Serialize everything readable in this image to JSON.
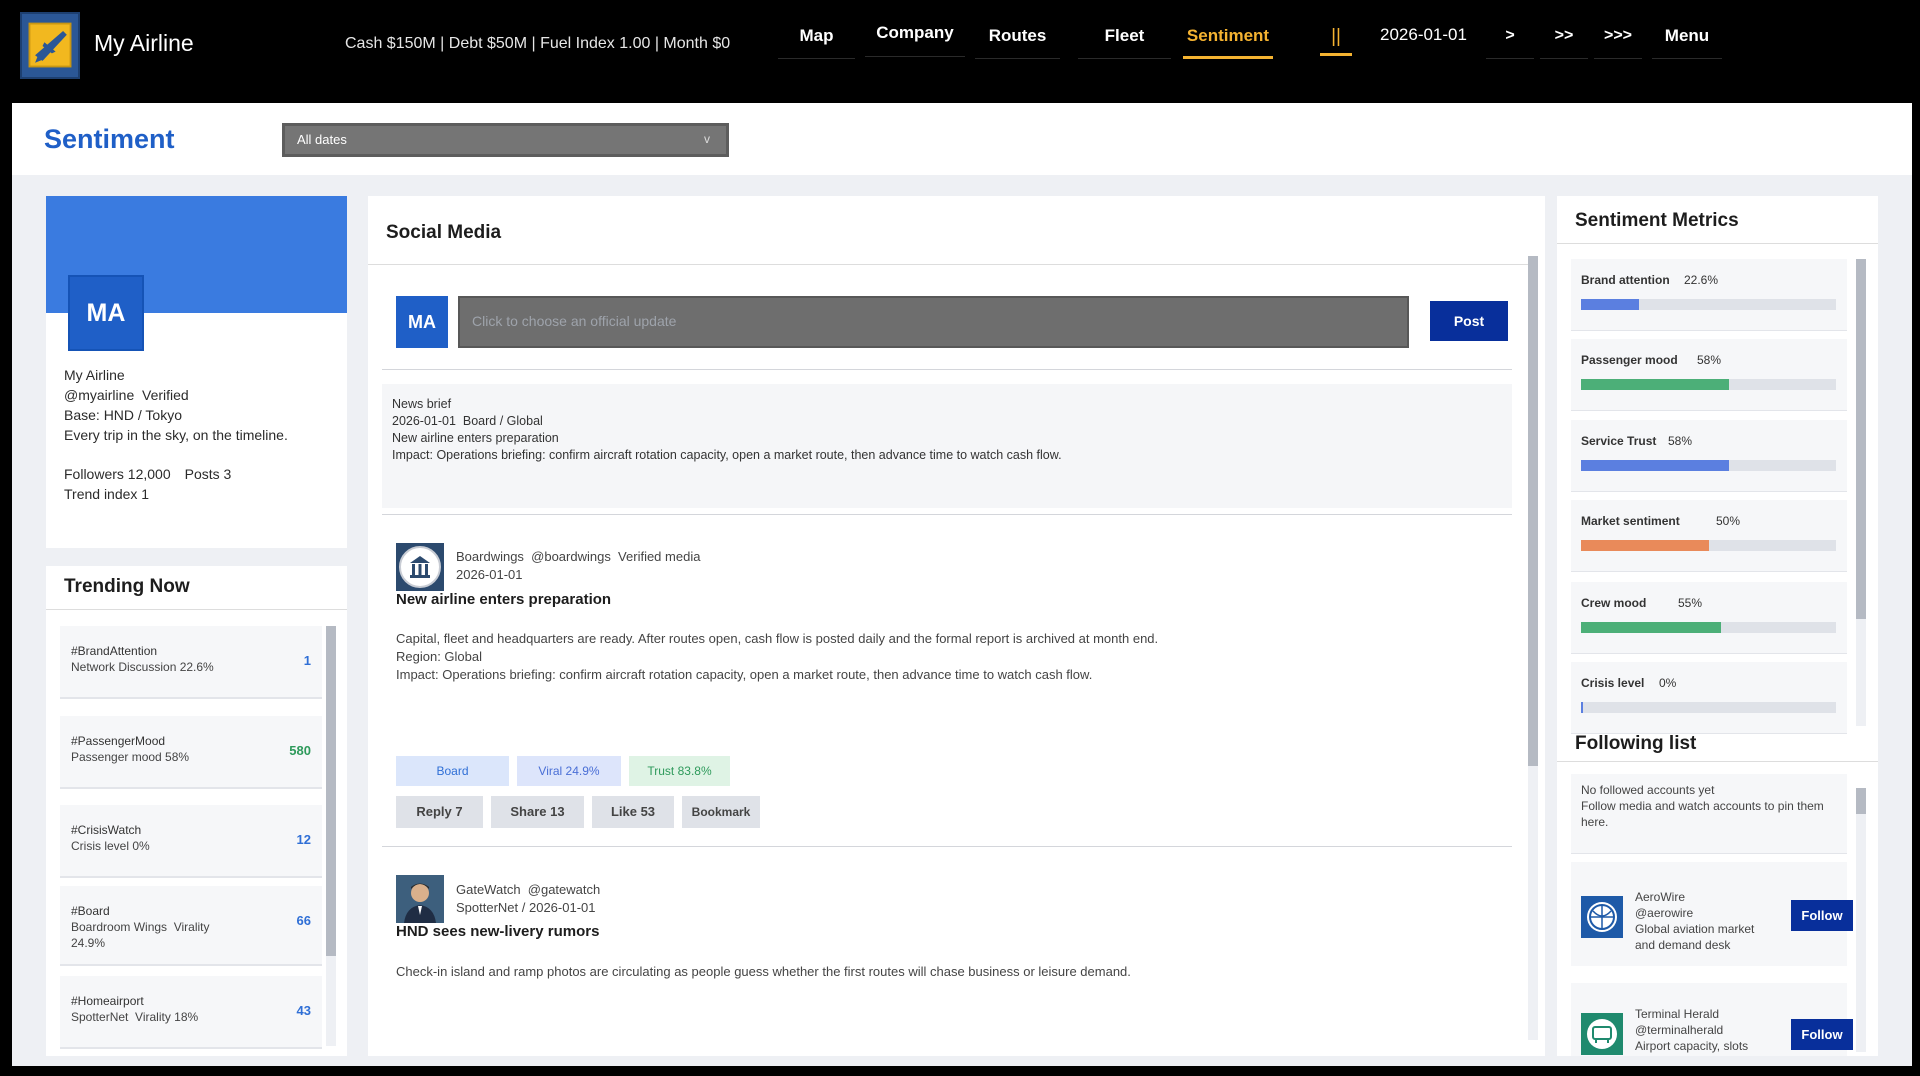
{
  "app": {
    "title": "My Airline",
    "logo_icon": "airline-plane-logo",
    "stats": "Cash $150M | Debt $50M | Fuel Index 1.00 | Month $0"
  },
  "nav": {
    "map": "Map",
    "company": "Company",
    "routes": "Routes",
    "fleet": "Fleet",
    "sentiment": "Sentiment",
    "active": "Sentiment"
  },
  "controls": {
    "pause": "||",
    "date": "2026-01-01",
    "speed1": ">",
    "speed2": ">>",
    "speed3": ">>>",
    "menu": "Menu"
  },
  "page": {
    "title": "Sentiment",
    "date_filter": "All dates",
    "date_filter_chevron": "v"
  },
  "profile": {
    "initials": "MA",
    "name": "My Airline",
    "handle_line": "@myairline  Verified",
    "base": "Base: HND / Tokyo",
    "tagline": "Every trip in the sky, on the timeline.",
    "followers": "Followers 12,000",
    "posts": "Posts 3",
    "trend_index": "Trend index 1"
  },
  "trending": {
    "title": "Trending Now",
    "items": [
      {
        "tag": "#BrandAttention",
        "sub": "Network Discussion 22.6%",
        "count": "1",
        "color": "#2f6fd6"
      },
      {
        "tag": "#PassengerMood",
        "sub": "Passenger mood 58%",
        "count": "580",
        "color": "#2e9a5b"
      },
      {
        "tag": "#CrisisWatch",
        "sub": "Crisis level 0%",
        "count": "12",
        "color": "#2f6fd6"
      },
      {
        "tag": "#Board",
        "sub": "Boardroom Wings  Virality 24.9%",
        "count": "66",
        "color": "#2f6fd6"
      },
      {
        "tag": "#Homeairport",
        "sub": "SpotterNet  Virality 18%",
        "count": "43",
        "color": "#2f6fd6"
      }
    ]
  },
  "feed": {
    "title": "Social Media",
    "composer_initials": "MA",
    "composer_placeholder": "Click to choose an official update",
    "post_button": "Post",
    "news_brief": {
      "kind": "News brief",
      "meta": "2026-01-01  Board / Global",
      "headline": "New airline enters preparation",
      "impact": "Impact: Operations briefing: confirm aircraft rotation capacity, open a market route, then advance time to watch cash flow."
    },
    "posts": [
      {
        "author_line": "Boardwings  @boardwings  Verified media",
        "date": "2026-01-01",
        "headline": "New airline enters preparation",
        "body1": "Capital, fleet and headquarters are ready. After routes open, cash flow is posted daily and the formal report is archived at month end.",
        "body2": "Region: Global",
        "body3": "Impact: Operations briefing: confirm aircraft rotation capacity, open a market route, then advance time to watch cash flow.",
        "tag_board": "Board",
        "tag_viral": "Viral 24.9%",
        "tag_trust": "Trust 83.8%",
        "reply": "Reply 7",
        "share": "Share 13",
        "like": "Like 53",
        "bookmark": "Bookmark",
        "avatar_icon": "bank-building-icon"
      },
      {
        "author_line": "GateWatch  @gatewatch",
        "date": "SpotterNet / 2026-01-01",
        "headline": "HND sees new-livery rumors",
        "body1": "Check-in island and ramp photos are circulating as people guess whether the first routes will chase business or leisure demand.",
        "avatar_icon": "person-portrait-icon"
      }
    ]
  },
  "metrics": {
    "title": "Sentiment Metrics",
    "items": [
      {
        "label": "Brand attention",
        "value": "22.6%",
        "fraction": 0.226,
        "color": "#5b7fe0"
      },
      {
        "label": "Passenger mood",
        "value": "58%",
        "fraction": 0.58,
        "color": "#4caf78"
      },
      {
        "label": "Service Trust",
        "value": "58%",
        "fraction": 0.58,
        "color": "#5b7fe0"
      },
      {
        "label": "Market sentiment",
        "value": "50%",
        "fraction": 0.5,
        "color": "#e98a5a"
      },
      {
        "label": "Crew mood",
        "value": "55%",
        "fraction": 0.55,
        "color": "#4caf78"
      },
      {
        "label": "Crisis level",
        "value": "0%",
        "fraction": 0.0,
        "color": "#5b7fe0"
      }
    ]
  },
  "following": {
    "title": "Following list",
    "empty_line1": "No followed accounts yet",
    "empty_line2": "Follow media and watch accounts to pin them here.",
    "suggestions": [
      {
        "name": "AeroWire",
        "handle": "@aerowire",
        "desc": "Global aviation market and demand desk",
        "button": "Follow",
        "icon": "globe-wire-icon"
      },
      {
        "name": "Terminal Herald",
        "handle": "@terminalherald",
        "desc": "Airport capacity, slots",
        "button": "Follow",
        "icon": "terminal-bus-icon"
      }
    ]
  },
  "colors": {
    "accent_gold": "#f5b331",
    "brand_blue": "#1f5fc7",
    "button_navy": "#082f9b"
  }
}
